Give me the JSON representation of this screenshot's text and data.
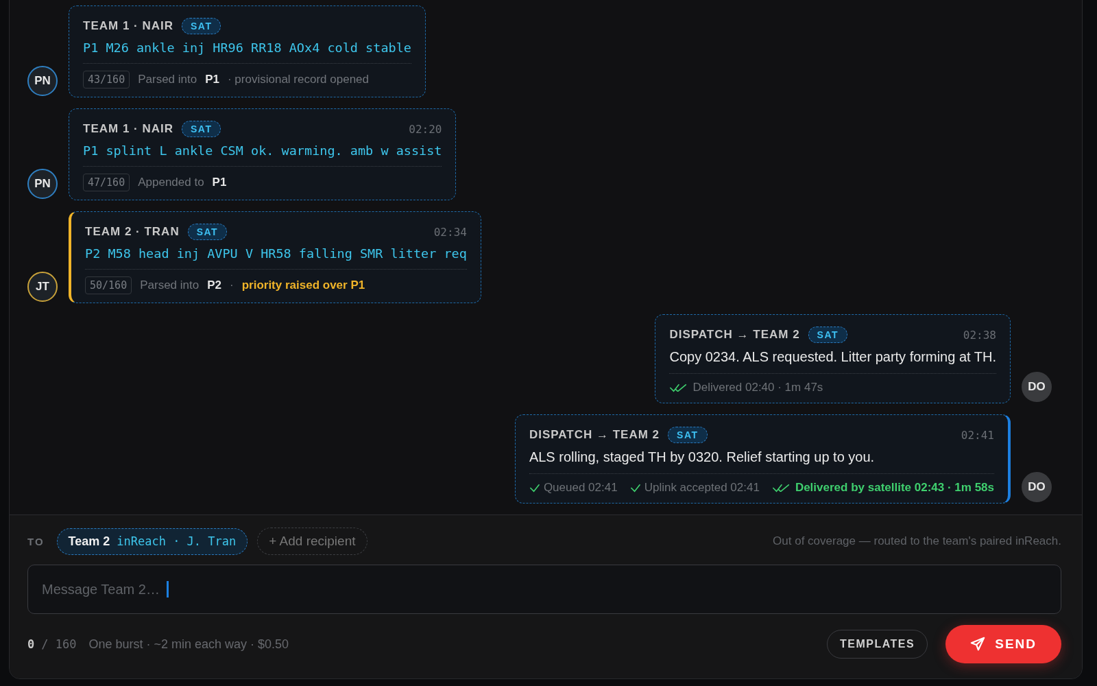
{
  "messages": [
    {
      "kind": "inbound",
      "sender": "TEAM 1 · NAIR",
      "badge": "SAT",
      "body": "P1 M26 ankle inj HR96 RR18 AOx4 cold stable",
      "avatar": "PN",
      "color": "#2f7fc1",
      "priority": false,
      "latest": false,
      "count": "43/160",
      "footer": [
        {
          "kind": "muted",
          "text": "Parsed into"
        },
        {
          "kind": "ref",
          "text": "P1"
        },
        {
          "kind": "muted",
          "text": "· provisional record opened"
        }
      ]
    },
    {
      "kind": "inbound",
      "sender": "TEAM 1 · NAIR",
      "badge": "SAT",
      "time": "02:20",
      "body": "P1 splint L ankle CSM ok. warming. amb w assist",
      "avatar": "PN",
      "color": "#2f7fc1",
      "priority": false,
      "latest": false,
      "count": "47/160",
      "footer": [
        {
          "kind": "muted",
          "text": "Appended to"
        },
        {
          "kind": "ref",
          "text": "P1"
        }
      ]
    },
    {
      "kind": "inbound",
      "sender": "TEAM 2 · TRAN",
      "badge": "SAT",
      "time": "02:34",
      "body": "P2 M58 head inj AVPU V HR58 falling SMR litter req",
      "avatar": "JT",
      "color": "#c9a23a",
      "priority": true,
      "latest": false,
      "count": "50/160",
      "footer": [
        {
          "kind": "muted",
          "text": "Parsed into"
        },
        {
          "kind": "ref",
          "text": "P2"
        },
        {
          "kind": "muted",
          "text": "·"
        },
        {
          "kind": "alert",
          "text": "priority raised over P1"
        }
      ]
    },
    {
      "kind": "outbound",
      "sender": "DISPATCH → TEAM 2",
      "badge": "SAT",
      "time": "02:38",
      "body": "Copy 0234. ALS requested. Litter party forming at TH.",
      "avatar": "DO",
      "color": "#3a3b3e",
      "priority": false,
      "latest": false,
      "status": [
        {
          "kind": "double",
          "emphasis": false,
          "text": "Delivered 02:40 · 1m 47s"
        }
      ]
    },
    {
      "kind": "outbound",
      "sender": "DISPATCH → TEAM 2",
      "badge": "SAT",
      "time": "02:41",
      "body": "ALS rolling, staged TH by 0320. Relief starting up to you.",
      "avatar": "DO",
      "color": "#3a3b3e",
      "priority": false,
      "latest": true,
      "status": [
        {
          "kind": "single",
          "emphasis": false,
          "text": "Queued 02:41"
        },
        {
          "kind": "single",
          "emphasis": false,
          "text": "Uplink accepted 02:41"
        },
        {
          "kind": "double",
          "emphasis": true,
          "text": "Delivered by satellite 02:43 · 1m 58s"
        }
      ]
    }
  ],
  "composer": {
    "to_label": "TO",
    "recipient": {
      "name": "Team 2",
      "device": "inReach · J. Tran"
    },
    "add_recipient": "+ Add recipient",
    "coverage_note": "Out of coverage — routed to the team's paired inReach.",
    "placeholder": "Message Team 2…",
    "focused": true,
    "count": "0",
    "limit": "/ 160",
    "cost_note": "One burst · ~2 min each way · $0.50",
    "buttons": [
      "TEMPLATES",
      "SEND"
    ]
  }
}
